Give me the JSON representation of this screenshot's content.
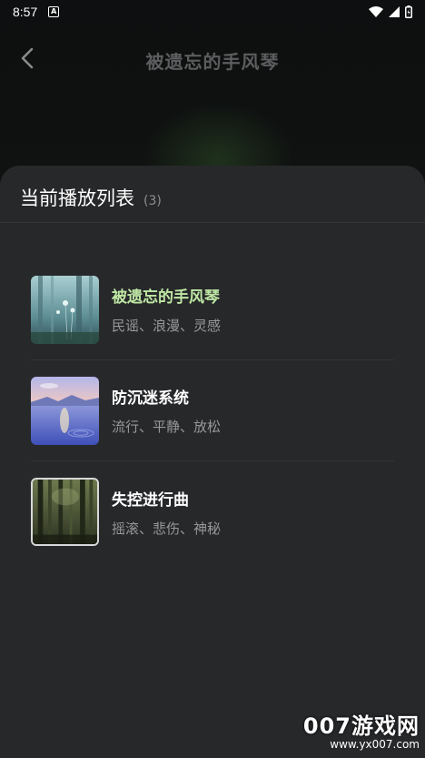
{
  "status_bar": {
    "time": "8:57",
    "notification_icon": "a-icon",
    "icons": [
      "wifi-icon",
      "signal-icon",
      "battery-icon"
    ]
  },
  "header": {
    "title": "被遗忘的手风琴",
    "back_icon": "chevron-left-icon"
  },
  "playlist": {
    "title": "当前播放列表",
    "count": "(3)",
    "items": [
      {
        "title": "被遗忘的手风琴",
        "tags": "民谣、浪漫、灵感",
        "active": true,
        "thumbnail": "misty-forest-dandelion"
      },
      {
        "title": "防沉迷系统",
        "tags": "流行、平静、放松",
        "active": false,
        "thumbnail": "calm-lake-sunset"
      },
      {
        "title": "失控进行曲",
        "tags": "摇滚、悲伤、神秘",
        "active": false,
        "thumbnail": "dark-forest"
      }
    ]
  },
  "watermark": {
    "main": "007游戏网",
    "sub": "www.yx007.com"
  },
  "colors": {
    "active_title": "#bfe7a4",
    "sheet_bg": "#27282a",
    "page_bg": "#0b0c0d"
  }
}
